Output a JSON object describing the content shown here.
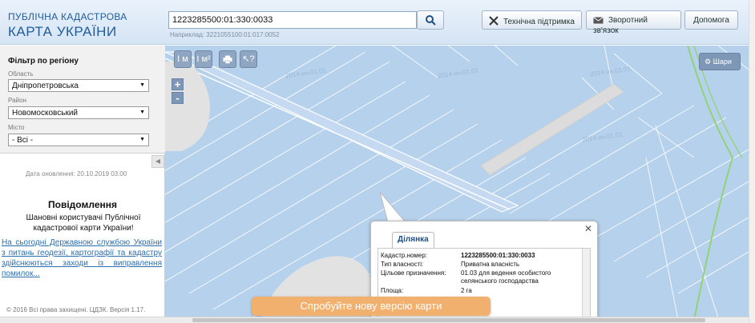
{
  "header": {
    "logo_line1": "ПУБЛІЧНА КАДАСТРОВА",
    "logo_line2": "КАРТА УКРАЇНИ",
    "search_value": "1223285500:01:330:0033",
    "search_example": "Наприклад: 3221055100:01:017:0052",
    "buttons": [
      "Технічна підтримка",
      "Зворотний зв'язок",
      "Допомога"
    ]
  },
  "sidebar": {
    "filter_title": "Фільтр по регіону",
    "oblast_label": "Область",
    "oblast_value": "Дніпропетровська",
    "rayon_label": "Район",
    "rayon_value": "Новомосковський",
    "misto_label": "Місто",
    "misto_value": "- Всі -",
    "updated": "Дата оновлення: 20.10.2019 03:00",
    "notice_title": "Повідомлення",
    "notice_text": "Шановні користувачі Публічної кадастрової карти України!",
    "notice_link": "На сьогодні Державною службою України з питань геодезії, картографії та кадастру здійснюються заходи із виправлення помилок...",
    "copyright": "© 2016 Всі права захищені. ЦДЗК. Версія 1.17."
  },
  "map": {
    "tools": [
      "I м",
      "I м²",
      "print",
      "↖?"
    ],
    "zoom_in": "+",
    "zoom_out": "-",
    "layers_label": "Шари",
    "watermark": "2014 ин.01.01",
    "popup": {
      "tab": "Ділянка",
      "rows": [
        {
          "label": "Кадастр.номер:",
          "value": "1223285500:01:330:0033"
        },
        {
          "label": "Тип власності:",
          "value": "Приватна власність"
        },
        {
          "label": "Цільове призначення:",
          "value": "01.03 для ведення особистого селянського господарства"
        },
        {
          "label": "Площа:",
          "value": "2 га"
        }
      ]
    },
    "banner": "Спробуйте нову версію карти"
  }
}
